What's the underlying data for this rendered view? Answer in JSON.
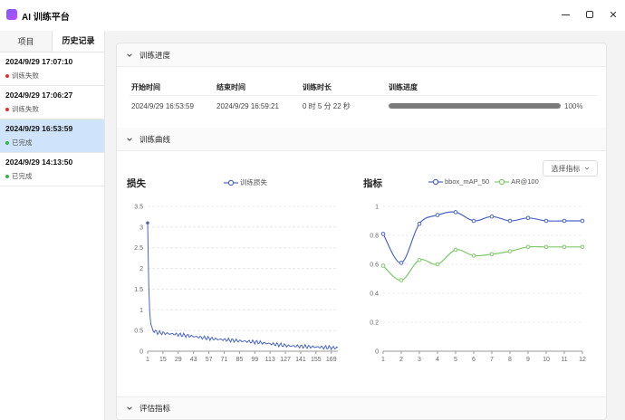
{
  "app": {
    "title": "AI 训练平台"
  },
  "sidebar": {
    "tabs": [
      {
        "label": "项目"
      },
      {
        "label": "历史记录"
      }
    ],
    "history": [
      {
        "time": "2024/9/29 17:07:10",
        "status": "训练失败",
        "color": "#e03131"
      },
      {
        "time": "2024/9/29 17:06:27",
        "status": "训练失败",
        "color": "#e03131"
      },
      {
        "time": "2024/9/29 16:53:59",
        "status": "已完成",
        "color": "#37b24d"
      },
      {
        "time": "2024/9/29 14:13:50",
        "status": "已完成",
        "color": "#37b24d"
      }
    ]
  },
  "progress_section": {
    "title": "训练进度",
    "headers": {
      "start": "开始时间",
      "end": "结束时间",
      "duration": "训练时长",
      "progress": "训练进度"
    },
    "row": {
      "start": "2024/9/29 16:53:59",
      "end": "2024/9/29 16:59:21",
      "duration": "0 时 5 分 22 秒",
      "progress_text": "100%",
      "progress_value": 1.0
    }
  },
  "curve_section": {
    "title": "训练曲线",
    "select_label": "选择指标"
  },
  "eval_section": {
    "title": "评估指标"
  },
  "loss_chart": {
    "title": "损失",
    "legend": "训练损失"
  },
  "metric_chart": {
    "title": "指标",
    "legend": [
      "bbox_mAP_50",
      "AR@100"
    ]
  },
  "chart_data": [
    {
      "type": "line",
      "title": "损失",
      "series": [
        {
          "name": "训练损失",
          "color": "#4a66c4"
        }
      ],
      "ylim": [
        0,
        3.5
      ],
      "yticks": [
        "0",
        "0.5",
        "1",
        "1.5",
        "2",
        "2.5",
        "3",
        "3.5"
      ],
      "xticks": [
        "1",
        "15",
        "29",
        "43",
        "57",
        "71",
        "85",
        "99",
        "113",
        "127",
        "141",
        "155",
        "169"
      ],
      "x_range": [
        1,
        175
      ],
      "key_points": [
        [
          1,
          3.1
        ],
        [
          2,
          1.6
        ],
        [
          3,
          0.9
        ],
        [
          4,
          0.65
        ],
        [
          6,
          0.5
        ],
        [
          10,
          0.45
        ],
        [
          30,
          0.4
        ],
        [
          60,
          0.3
        ],
        [
          100,
          0.22
        ],
        [
          130,
          0.13
        ],
        [
          155,
          0.1
        ],
        [
          175,
          0.08
        ]
      ]
    },
    {
      "type": "line",
      "title": "指标",
      "ylim": [
        0,
        1
      ],
      "yticks": [
        "0",
        "0.2",
        "0.4",
        "0.6",
        "0.8",
        "1"
      ],
      "x": [
        1,
        2,
        3,
        4,
        5,
        6,
        7,
        8,
        9,
        10,
        11,
        12
      ],
      "series": [
        {
          "name": "bbox_mAP_50",
          "color": "#4a66c4",
          "values": [
            0.81,
            0.61,
            0.88,
            0.94,
            0.96,
            0.9,
            0.93,
            0.9,
            0.92,
            0.9,
            0.9,
            0.9
          ]
        },
        {
          "name": "AR@100",
          "color": "#7fc96b",
          "values": [
            0.59,
            0.49,
            0.63,
            0.6,
            0.7,
            0.66,
            0.67,
            0.69,
            0.72,
            0.72,
            0.72,
            0.72
          ]
        }
      ]
    }
  ]
}
